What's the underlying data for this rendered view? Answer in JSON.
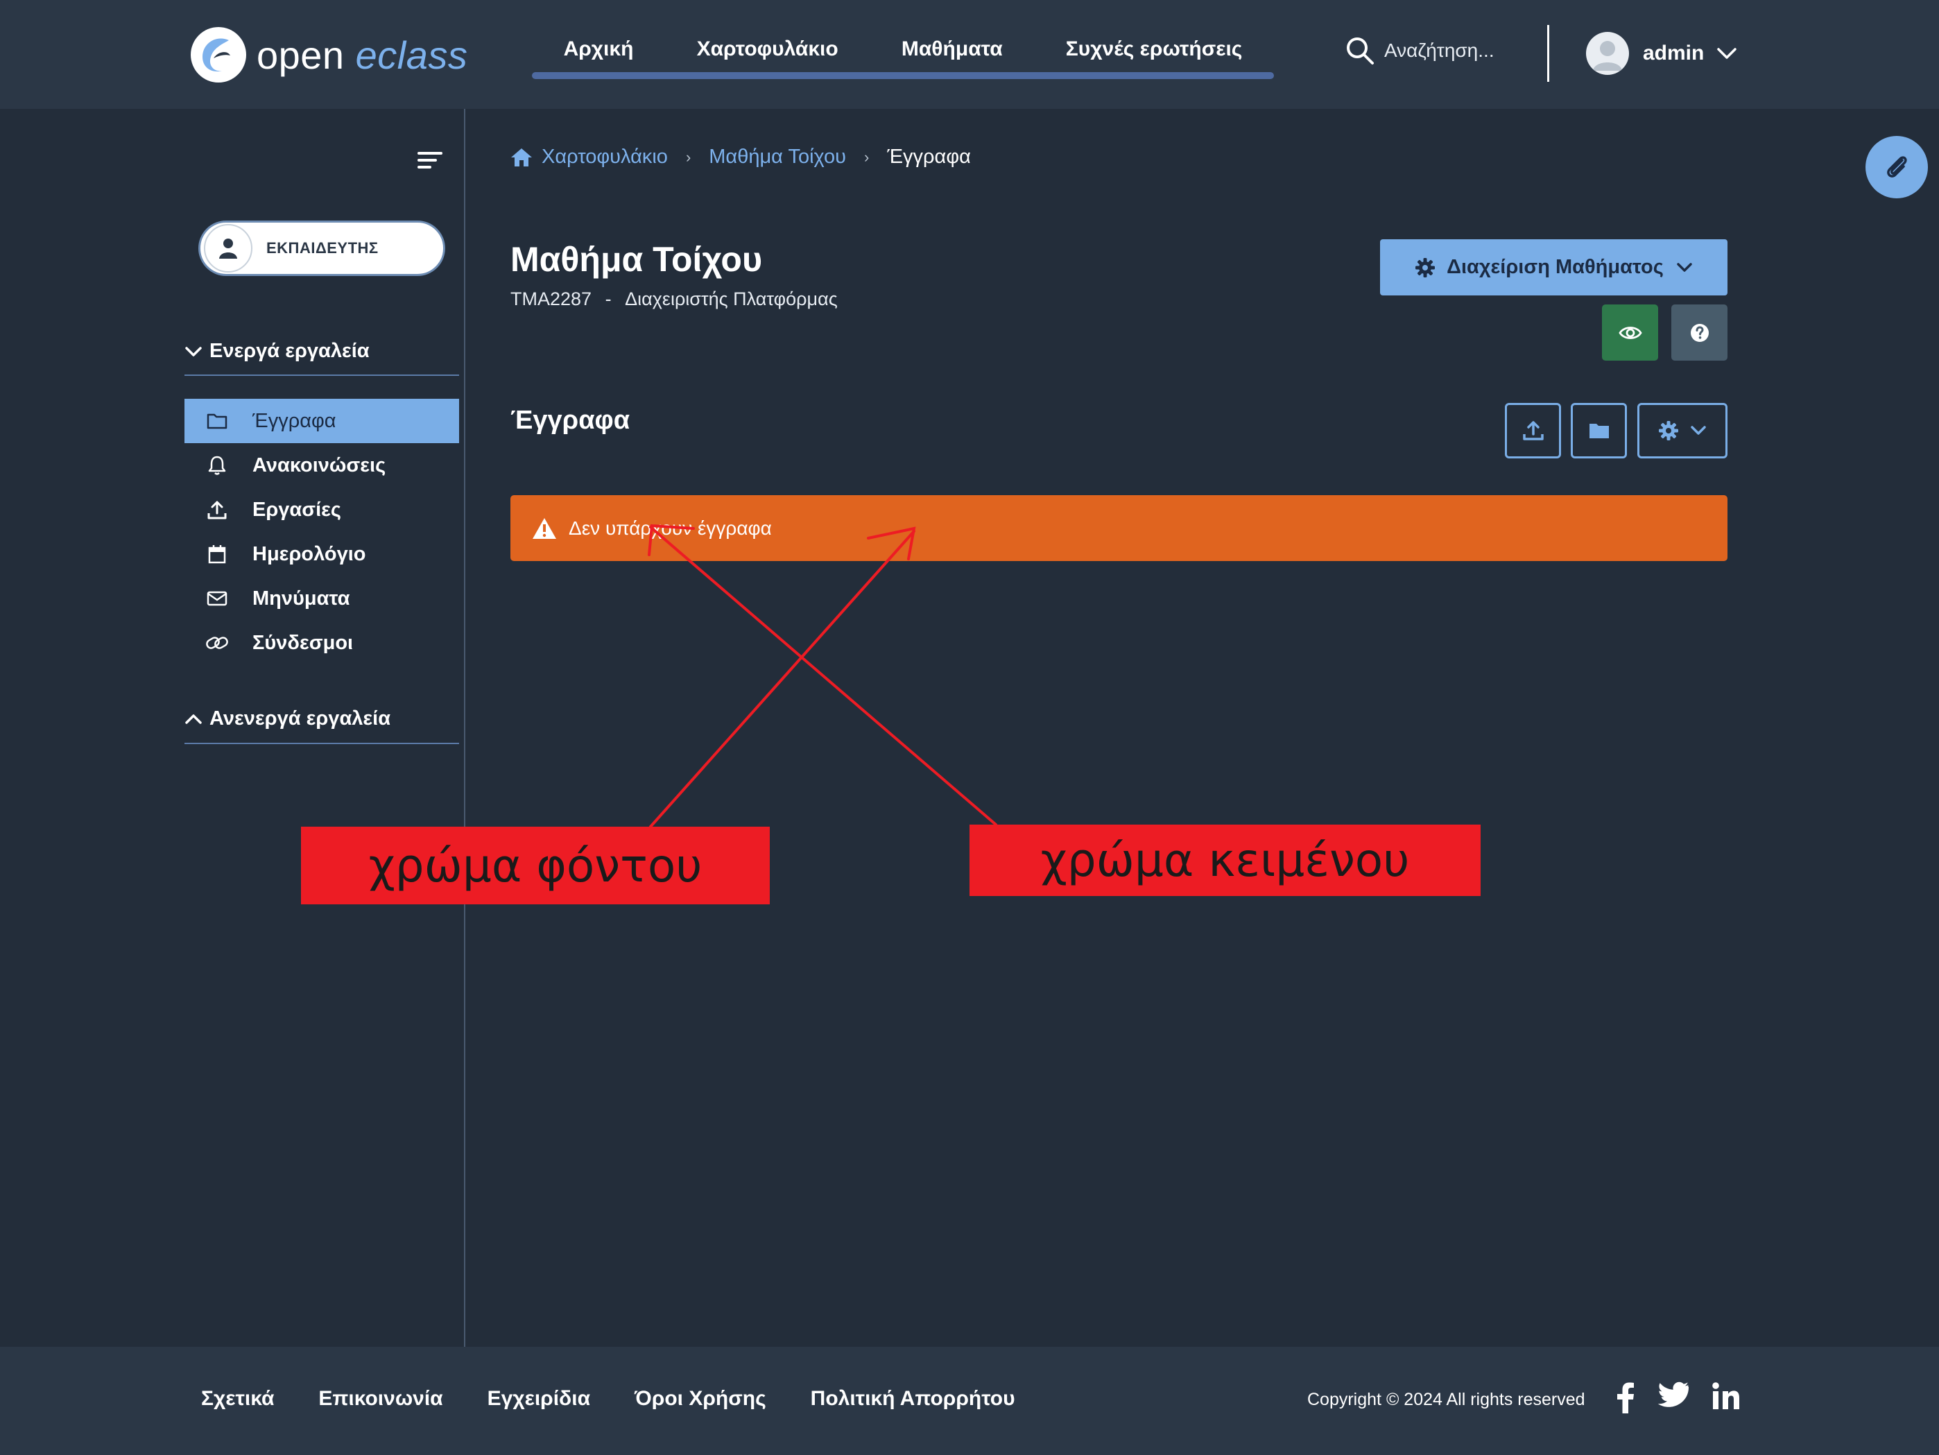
{
  "header": {
    "logo_text_a": "open ",
    "logo_text_b": "eclass",
    "nav": [
      "Αρχική",
      "Χαρτοφυλάκιο",
      "Μαθήματα",
      "Συχνές ερωτήσεις"
    ],
    "search_placeholder": "Αναζήτηση...",
    "user_name": "admin"
  },
  "sidebar": {
    "role": "ΕΚΠΑΙΔΕΥΤΗΣ",
    "active_section": "Ενεργά εργαλεία",
    "tools": [
      "Έγγραφα",
      "Ανακοινώσεις",
      "Εργασίες",
      "Ημερολόγιο",
      "Μηνύματα",
      "Σύνδεσμοι"
    ],
    "active_tool_index": 0,
    "inactive_section": "Ανενεργά εργαλεία"
  },
  "breadcrumb": {
    "items": [
      "Χαρτοφυλάκιο",
      "Μαθήμα Τοίχου"
    ],
    "current": "Έγγραφα"
  },
  "course": {
    "title": "Μαθήμα Τοίχου",
    "code": "TMA2287",
    "separator": "-",
    "owner": "Διαχειριστής Πλατφόρμας",
    "manage_label": "Διαχείριση Μαθήματος"
  },
  "documents": {
    "title": "Έγγραφα",
    "alert_text": "Δεν υπάρχουν έγγραφα"
  },
  "annotations": {
    "background_label": "χρώμα φόντου",
    "text_label": "χρώμα κειμένου",
    "color": "#ed1c24"
  },
  "footer": {
    "links": [
      "Σχετικά",
      "Επικοινωνία",
      "Εγχειρίδια",
      "Όροι Χρήσης",
      "Πολιτική Απορρήτου"
    ],
    "copyright": "Copyright © 2024 All rights reserved"
  },
  "colors": {
    "background": "#232d3a",
    "header": "#2b3746",
    "accent": "#7aaee7",
    "alert": "#e0641f",
    "success": "#2e7a4b"
  },
  "icons": [
    "search-icon",
    "user-avatar-icon",
    "chevron-down-icon",
    "menu-toggle-icon",
    "folder-icon",
    "bell-icon",
    "upload-icon",
    "calendar-icon",
    "envelope-icon",
    "link-icon",
    "home-icon",
    "gear-icon",
    "eye-icon",
    "help-icon",
    "warning-icon",
    "paperclip-icon",
    "facebook-icon",
    "twitter-icon",
    "linkedin-icon"
  ]
}
